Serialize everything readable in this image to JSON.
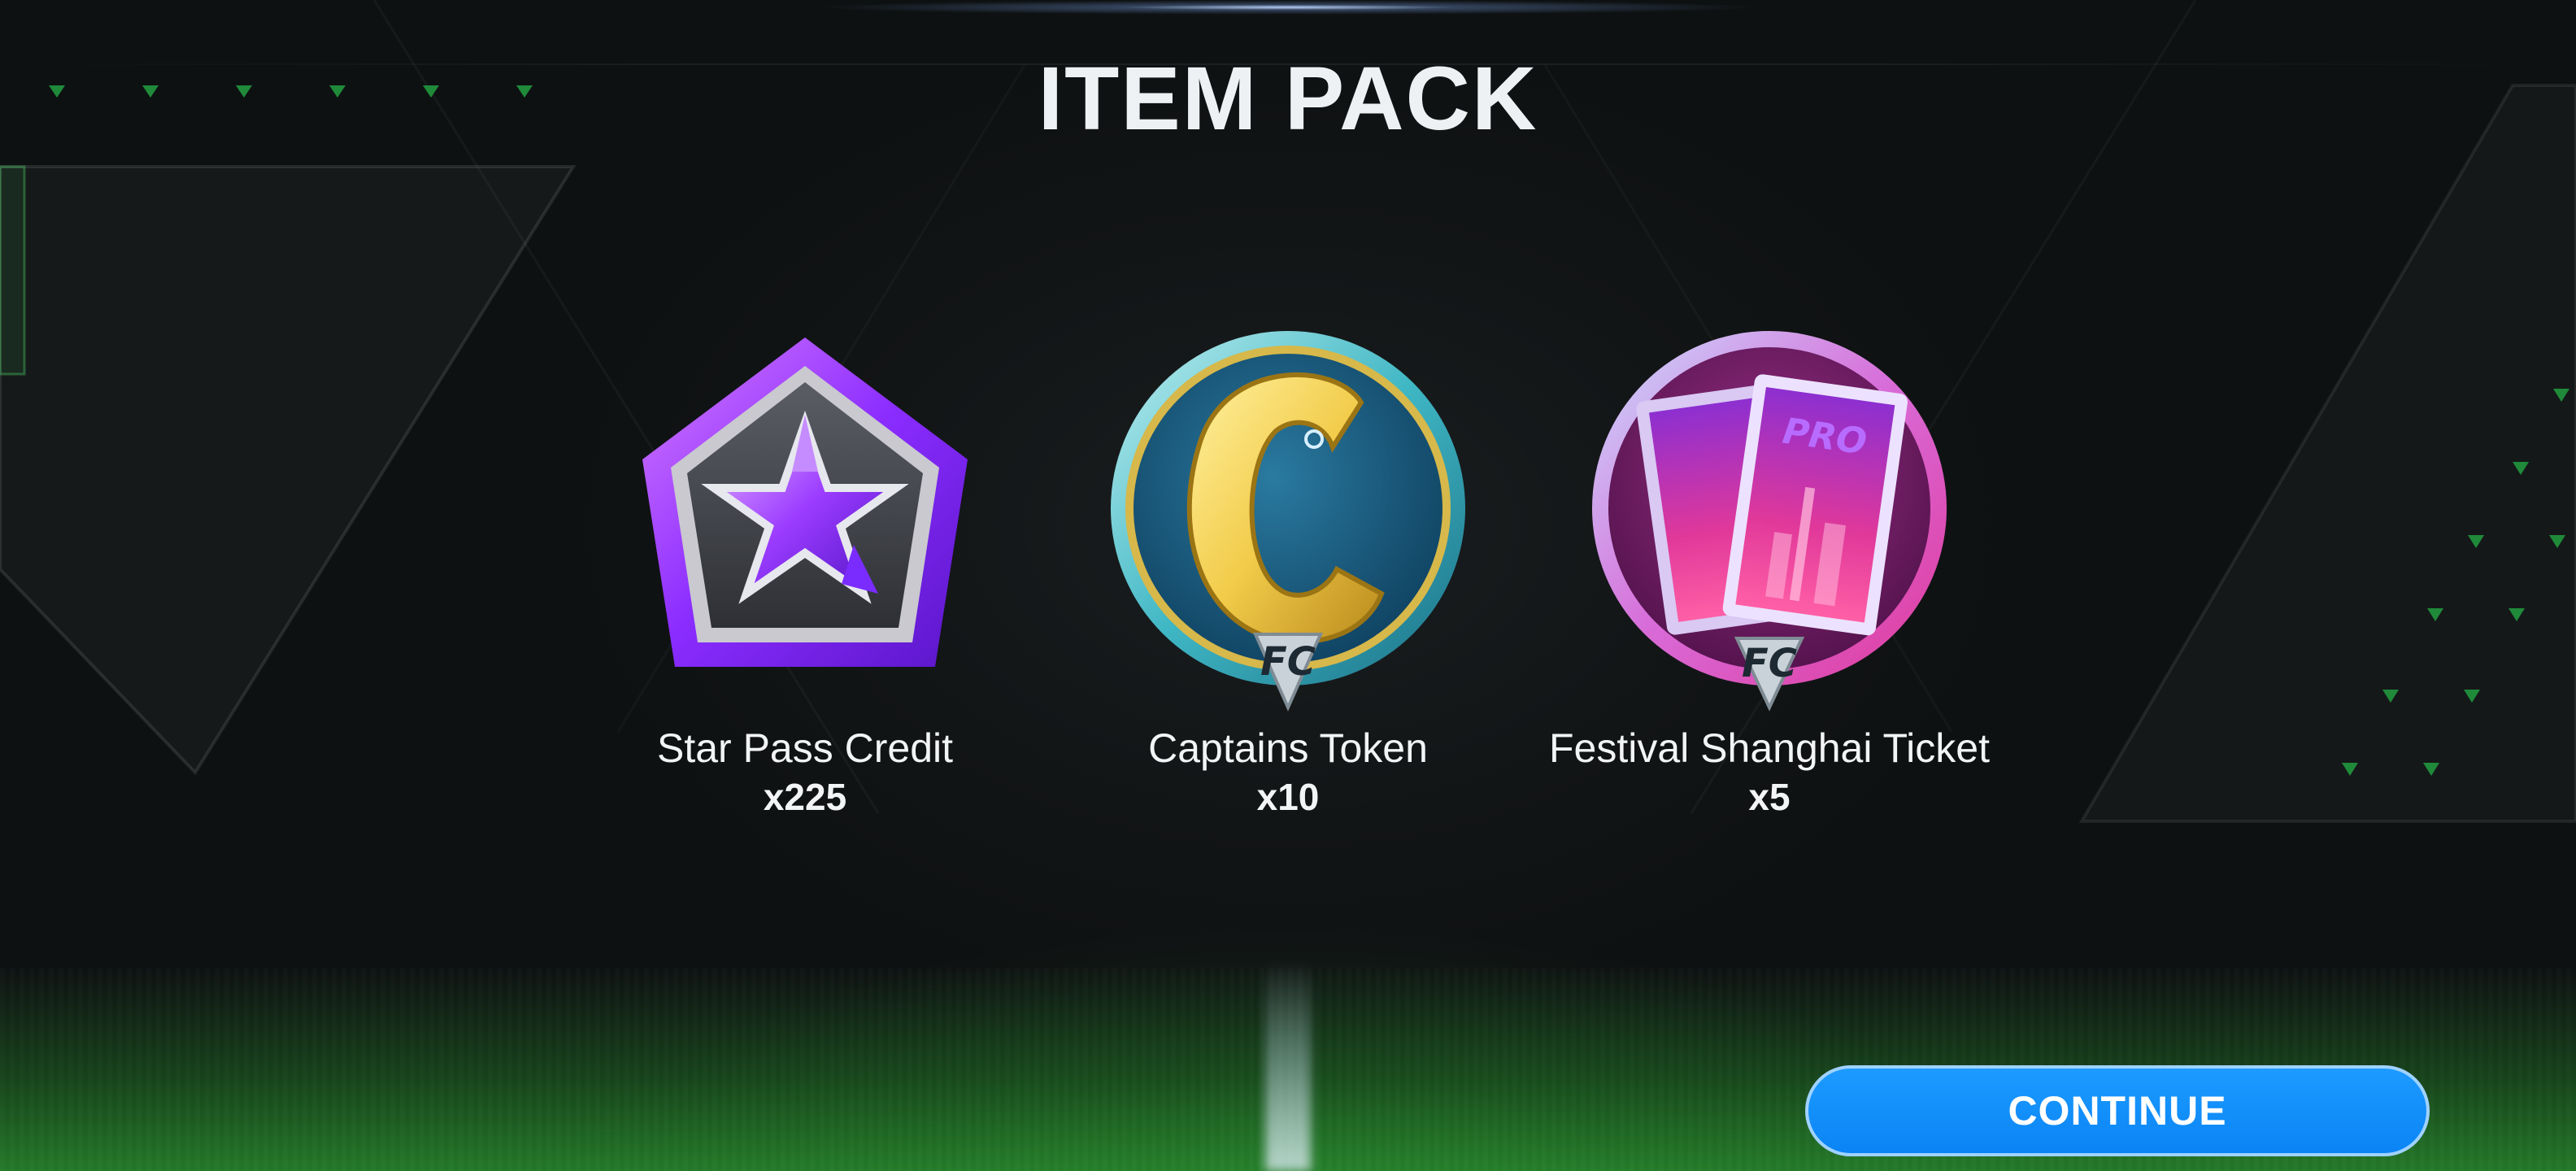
{
  "header": {
    "title": "ITEM PACK"
  },
  "items": [
    {
      "name": "Star Pass Credit",
      "quantity": "x225",
      "icon": "star-pass-credit-icon"
    },
    {
      "name": "Captains Token",
      "quantity": "x10",
      "icon": "captains-token-icon",
      "letter": "C",
      "badge": "FC"
    },
    {
      "name": "Festival Shanghai Ticket",
      "quantity": "x5",
      "icon": "festival-shanghai-ticket-icon",
      "ticket_text": "PRO",
      "badge": "FC"
    }
  ],
  "footer": {
    "continue_label": "CONTINUE"
  },
  "colors": {
    "accent_button": "#0a84f5",
    "star_purple": "#8a2cff",
    "captain_gold": "#f2cc4a",
    "ticket_pink": "#e0389a",
    "field_green": "#2a8c2f"
  }
}
